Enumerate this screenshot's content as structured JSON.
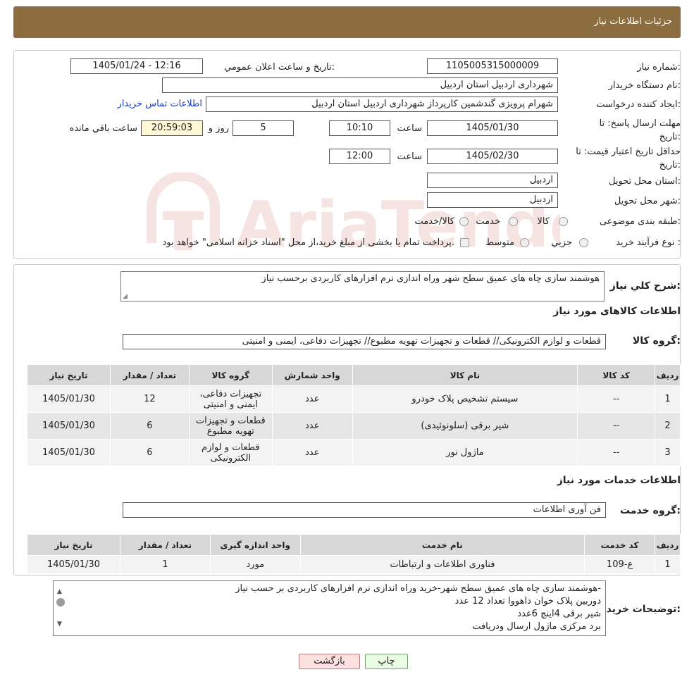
{
  "header": {
    "title": "جزئیات اطلاعات نیاز"
  },
  "info": {
    "need_number_label": "شماره نیاز:",
    "need_number": "1105005315000009",
    "announce_label": "تاریخ و ساعت اعلان عمومي:",
    "announce_value": "1405/01/24 - 12:16",
    "buyer_label": "نام دستگاه خريدار:",
    "buyer_value": "شهرداری اردبیل استان اردبیل",
    "creator_label": "ايجاد کننده درخواست:",
    "creator_value": "شهرام پرویزی گندشمین کارپرداز شهرداری اردبیل استان اردبیل",
    "contact_link": "اطلاعات تماس خريدار",
    "deadline_label_1": "مهلت ارسال پاسخ: تا",
    "deadline_label_2": "تاريخ:",
    "deadline_date": "1405/01/30",
    "time_label": "ساعت",
    "deadline_time": "10:10",
    "days_value": "5",
    "days_label": "روز و",
    "remaining_time": "20:59:03",
    "remaining_label": "ساعت باقي مانده",
    "validity_label_1": "حداقل تاريخ اعتبار قيمت: تا",
    "validity_label_2": "تاريخ:",
    "validity_date": "1405/02/30",
    "validity_time": "12:00",
    "province_label": "استان محل تحويل:",
    "province_value": "اردبیل",
    "city_label": "شهر محل تحويل:",
    "city_value": "اردبیل",
    "category_label": "طبقه بندی موضوعی:",
    "category_options": [
      "کالا",
      "خدمت",
      "کالا/خدمت"
    ],
    "process_label": "نوع فرآيند خريد :",
    "process_options": [
      "جزيي",
      "متوسط"
    ],
    "process_note": "پرداخت تمام يا بخشی از مبلغ خريد،از محل \"اسناد خزانه اسلامی\" خواهد بود."
  },
  "description": {
    "label": "شرح كلي نياز:",
    "value": "هوشمند سازی چاه های عمیق سطح شهر وراه اندازی نرم افزارهای کاربردی برحسب نیاز"
  },
  "goods": {
    "section_title": "اطلاعات کالاهای مورد نياز",
    "group_label": "گروه کالا:",
    "group_value": "قطعات و لوازم الکترونیکی// قطعات و تجهیزات تهویه مطبوع// تجهیزات دفاعی، ایمنی و امنیتی",
    "columns": [
      "رديف",
      "کد کالا",
      "نام کالا",
      "واحد شمارش",
      "گروه کالا",
      "تعداد / مقدار",
      "تاريخ نياز"
    ],
    "rows": [
      [
        "1",
        "--",
        "سیستم تشخیص پلاک خودرو",
        "عدد",
        "تجهیزات دفاعی، ایمنی و امنیتی",
        "12",
        "1405/01/30"
      ],
      [
        "2",
        "--",
        "شیر برقی (سلونوئیدی)",
        "عدد",
        "قطعات و تجهیزات تهویه مطبوع",
        "6",
        "1405/01/30"
      ],
      [
        "3",
        "--",
        "ماژول نور",
        "عدد",
        "قطعات و لوازم الکترونیکی",
        "6",
        "1405/01/30"
      ]
    ]
  },
  "services": {
    "section_title": "اطلاعات خدمات مورد نياز",
    "group_label": "گروه خدمت:",
    "group_value": "فن آوری اطلاعات",
    "columns": [
      "رديف",
      "کد خدمت",
      "نام خدمت",
      "واحد اندازه گيری",
      "تعداد / مقدار",
      "تاريخ نياز"
    ],
    "rows": [
      [
        "1",
        "ع-109",
        "فناوری اطلاعات و ارتباطات",
        "مورد",
        "1",
        "1405/01/30"
      ]
    ]
  },
  "buyer_notes": {
    "label": "توضيحات خريدار:",
    "lines": [
      "هوشمند سازی چاه های عمیق سطح شهر-خرید وراه اندازی نرم افزارهای کاربردی بر حسب نیاز-",
      "دوربین پلاک خوان  داهووا تعداد 12 عدد",
      "شیر برقی 4اینچ 6عدد",
      "برد مرکزی  ماژول ارسال ودریافت"
    ]
  },
  "buttons": {
    "print": "چاپ",
    "back": "بازگشت"
  },
  "colors": {
    "header": "#8b6d3f",
    "link": "#1a3cc8",
    "print_bg": "#eafbe4",
    "back_bg": "#fde1e1"
  }
}
